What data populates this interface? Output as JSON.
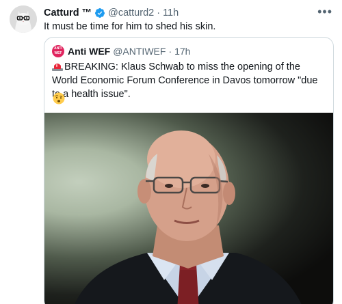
{
  "tweet": {
    "display_name": "Catturd ™",
    "handle": "@catturd2",
    "separator": "·",
    "time": "11h",
    "more_label": "•••",
    "text": "It must be time for him to shed his skin."
  },
  "quote": {
    "display_name": "Anti WEF",
    "avatar_text": "ANTI WEF",
    "handle": "@ANTIWEF",
    "separator": "·",
    "time": "17h",
    "text": "BREAKING: Klaus Schwab to miss the opening of the World Economic Forum Conference in Davos tomorrow \"due to a health issue\"."
  },
  "icons": {
    "verified": "verified-badge-icon",
    "siren": "rotating-light-icon",
    "emoji": "face-with-raised-eyebrow-icon",
    "more": "more-options-icon"
  },
  "colors": {
    "verified_blue": "#1d9bf0",
    "secondary_text": "#536471",
    "border": "#cfd9de",
    "anti_wef_red": "#e0245e"
  }
}
